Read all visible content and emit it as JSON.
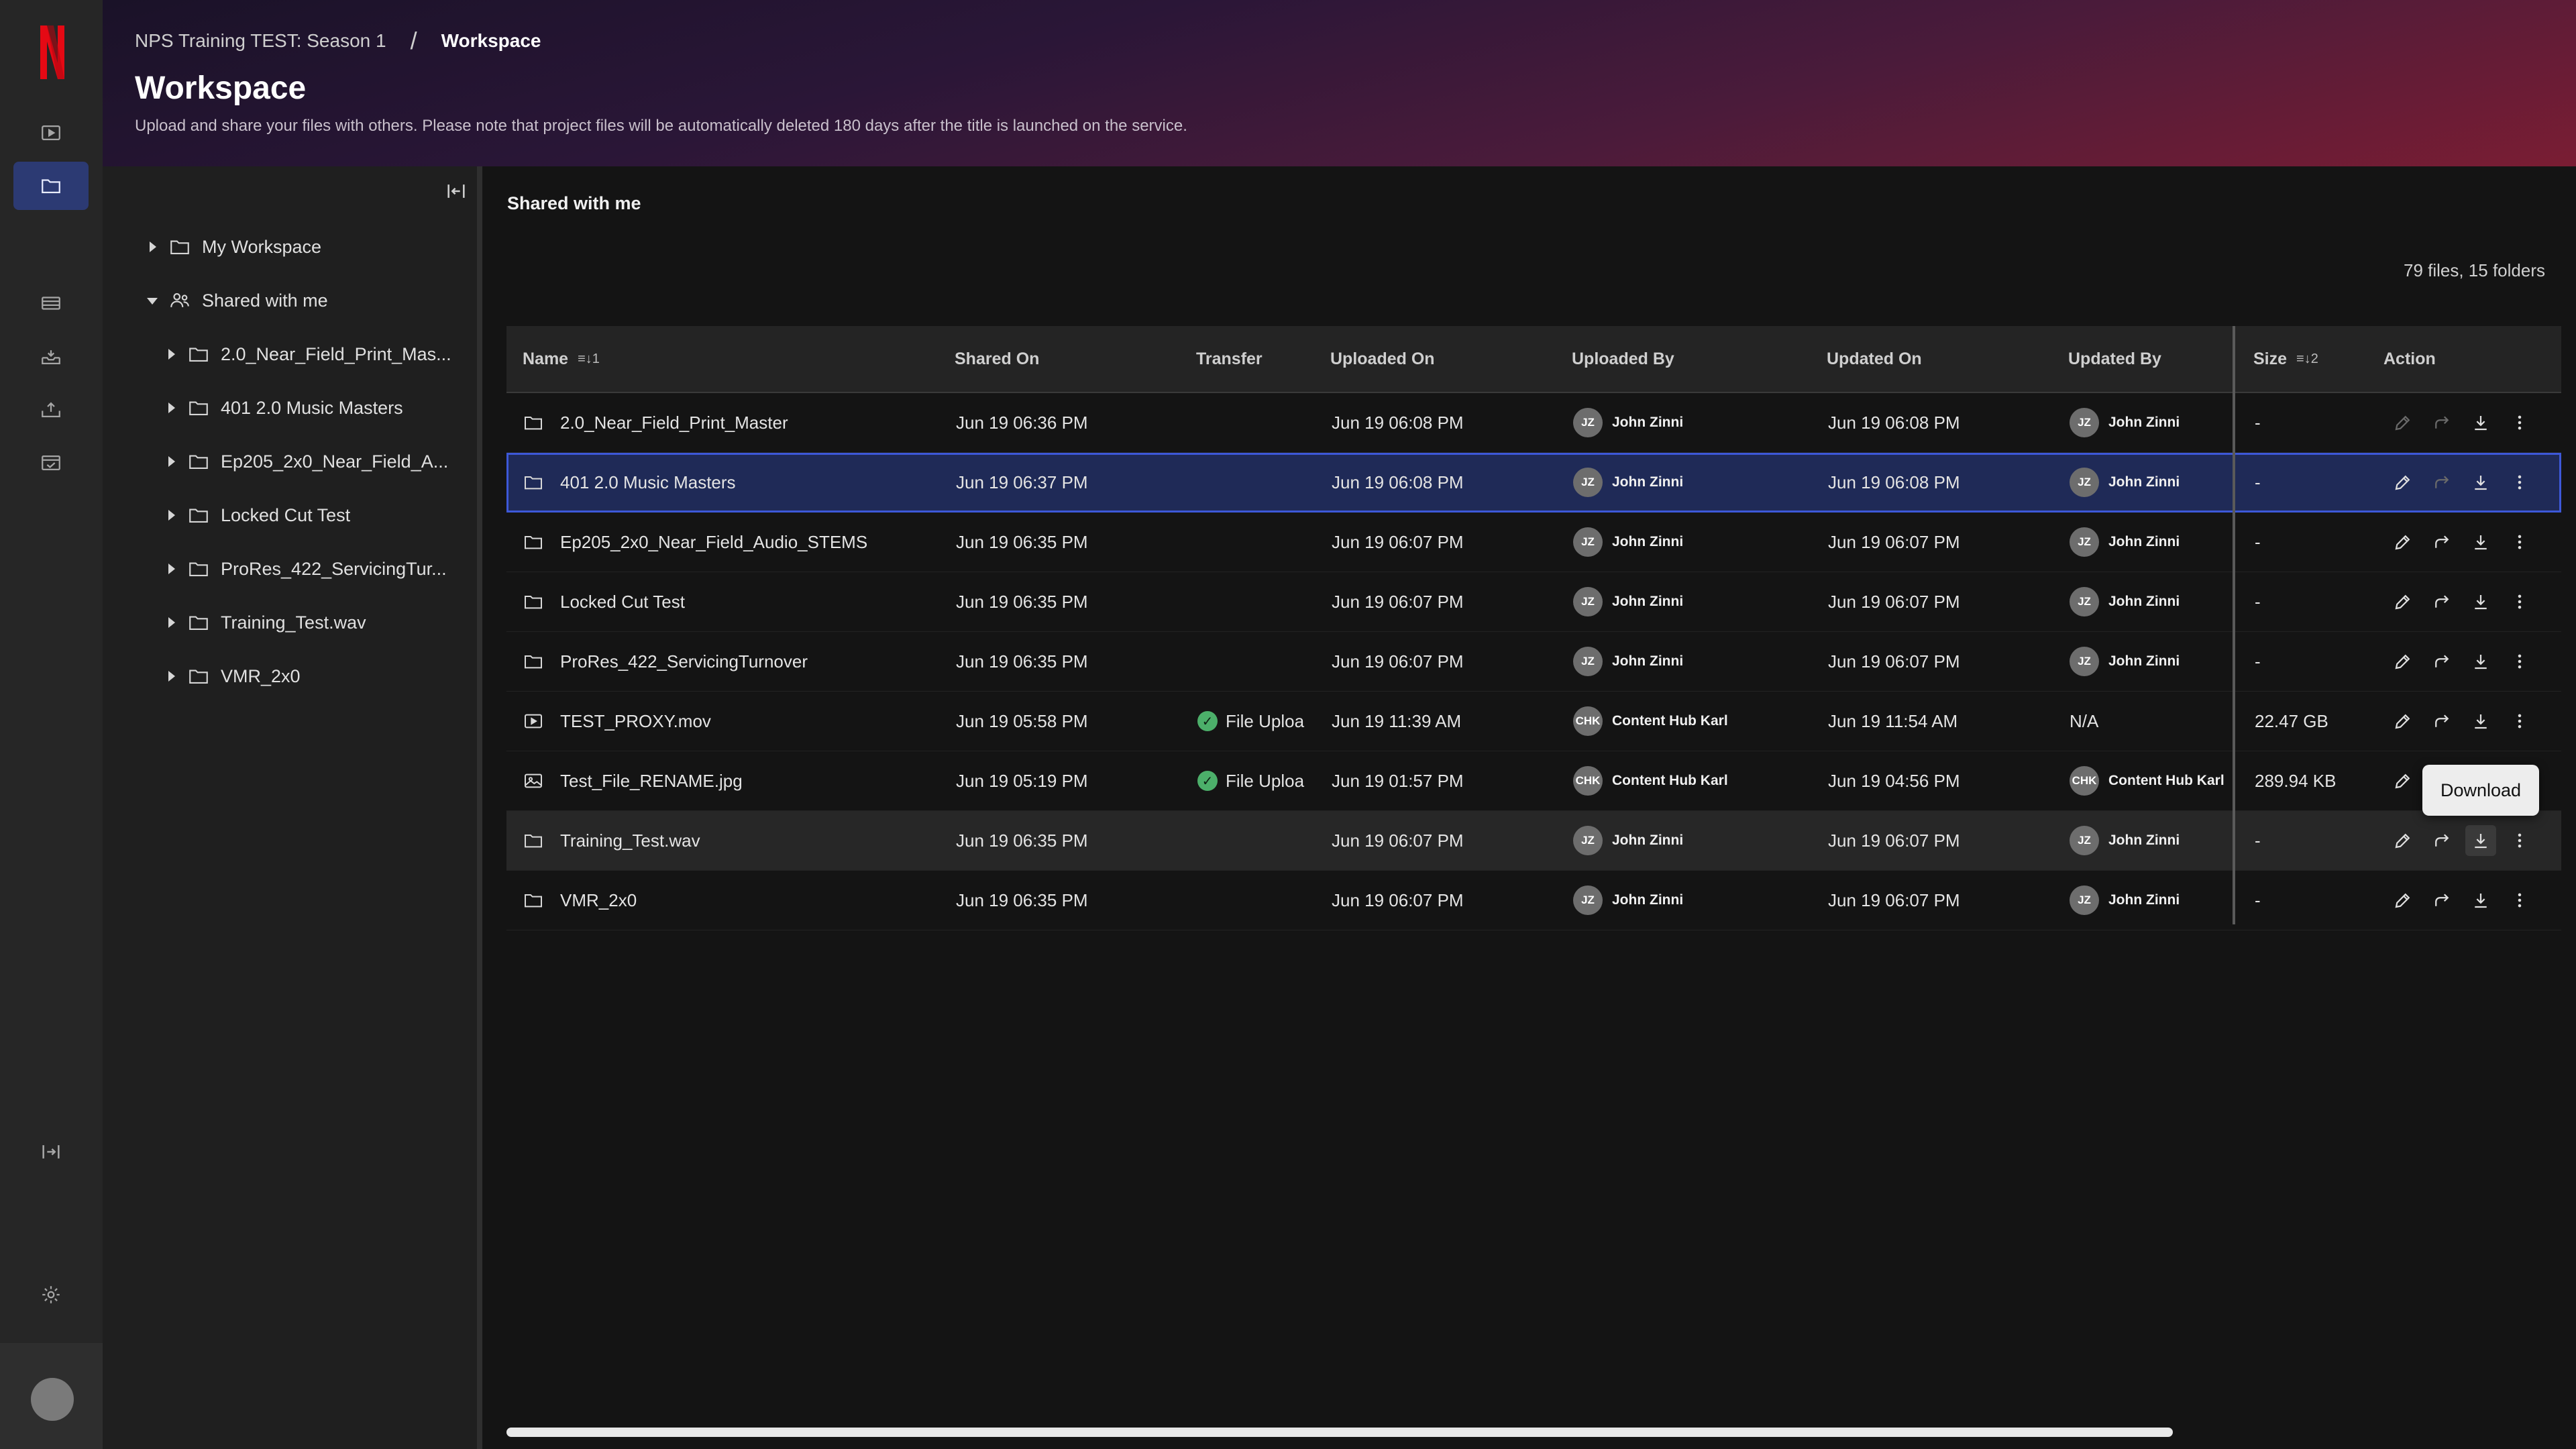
{
  "breadcrumb": {
    "project": "NPS Training TEST: Season 1",
    "separator": "/",
    "current": "Workspace"
  },
  "page": {
    "title": "Workspace",
    "description": "Upload and share your files with others. Please note that project files will be automatically deleted 180 days after the title is launched on the service."
  },
  "rail": {
    "logo": "N",
    "icons": [
      "play-icon",
      "folder-icon",
      "film-icon",
      "inbox-icon",
      "upload-icon",
      "calendar-check-icon",
      "expand-sidebar-icon",
      "gear-icon"
    ],
    "active": "folder-icon"
  },
  "tree": {
    "my_workspace": "My Workspace",
    "shared": "Shared with me",
    "children": [
      "2.0_Near_Field_Print_Mas...",
      "401 2.0 Music Masters",
      "Ep205_2x0_Near_Field_A...",
      "Locked Cut Test",
      "ProRes_422_ServicingTur...",
      "Training_Test.wav",
      "VMR_2x0"
    ]
  },
  "main": {
    "section_title": "Shared with me",
    "counts": "79 files, 15 folders",
    "columns": {
      "name": "Name",
      "name_sort": "≡↓1",
      "shared_on": "Shared On",
      "transfer": "Transfer",
      "uploaded_on": "Uploaded On",
      "uploaded_by": "Uploaded By",
      "updated_on": "Updated On",
      "updated_by": "Updated By",
      "size": "Size",
      "size_sort": "≡↓2",
      "action": "Action"
    },
    "rows": [
      {
        "type": "folder",
        "name": "2.0_Near_Field_Print_Master",
        "shared_on": "Jun 19 06:36 PM",
        "transfer": "",
        "uploaded_on": "Jun 19 06:08 PM",
        "uploaded_by_initials": "JZ",
        "uploaded_by": "John Zinni",
        "updated_on": "Jun 19 06:08 PM",
        "updated_by_initials": "JZ",
        "updated_by": "John Zinni",
        "size": "-"
      },
      {
        "type": "folder",
        "name": "401 2.0 Music Masters",
        "shared_on": "Jun 19 06:37 PM",
        "transfer": "",
        "uploaded_on": "Jun 19 06:08 PM",
        "uploaded_by_initials": "JZ",
        "uploaded_by": "John Zinni",
        "updated_on": "Jun 19 06:08 PM",
        "updated_by_initials": "JZ",
        "updated_by": "John Zinni",
        "size": "-"
      },
      {
        "type": "folder",
        "name": "Ep205_2x0_Near_Field_Audio_STEMS",
        "shared_on": "Jun 19 06:35 PM",
        "transfer": "",
        "uploaded_on": "Jun 19 06:07 PM",
        "uploaded_by_initials": "JZ",
        "uploaded_by": "John Zinni",
        "updated_on": "Jun 19 06:07 PM",
        "updated_by_initials": "JZ",
        "updated_by": "John Zinni",
        "size": "-"
      },
      {
        "type": "folder",
        "name": "Locked Cut Test",
        "shared_on": "Jun 19 06:35 PM",
        "transfer": "",
        "uploaded_on": "Jun 19 06:07 PM",
        "uploaded_by_initials": "JZ",
        "uploaded_by": "John Zinni",
        "updated_on": "Jun 19 06:07 PM",
        "updated_by_initials": "JZ",
        "updated_by": "John Zinni",
        "size": "-"
      },
      {
        "type": "folder",
        "name": "ProRes_422_ServicingTurnover",
        "shared_on": "Jun 19 06:35 PM",
        "transfer": "",
        "uploaded_on": "Jun 19 06:07 PM",
        "uploaded_by_initials": "JZ",
        "uploaded_by": "John Zinni",
        "updated_on": "Jun 19 06:07 PM",
        "updated_by_initials": "JZ",
        "updated_by": "John Zinni",
        "size": "-"
      },
      {
        "type": "video",
        "name": "TEST_PROXY.mov",
        "shared_on": "Jun 19 05:58 PM",
        "transfer": "File Uploa",
        "uploaded_on": "Jun 19 11:39 AM",
        "uploaded_by_initials": "CHK",
        "uploaded_by": "Content Hub Karl",
        "updated_on": "Jun 19 11:54 AM",
        "updated_by_initials": "",
        "updated_by": "N/A",
        "size": "22.47 GB"
      },
      {
        "type": "image",
        "name": "Test_File_RENAME.jpg",
        "shared_on": "Jun 19 05:19 PM",
        "transfer": "File Uploa",
        "uploaded_on": "Jun 19 01:57 PM",
        "uploaded_by_initials": "CHK",
        "uploaded_by": "Content Hub Karl",
        "updated_on": "Jun 19 04:56 PM",
        "updated_by_initials": "CHK",
        "updated_by": "Content Hub Karl",
        "size": "289.94 KB"
      },
      {
        "type": "folder",
        "name": "Training_Test.wav",
        "shared_on": "Jun 19 06:35 PM",
        "transfer": "",
        "uploaded_on": "Jun 19 06:07 PM",
        "uploaded_by_initials": "JZ",
        "uploaded_by": "John Zinni",
        "updated_on": "Jun 19 06:07 PM",
        "updated_by_initials": "JZ",
        "updated_by": "John Zinni",
        "size": "-"
      },
      {
        "type": "folder",
        "name": "VMR_2x0",
        "shared_on": "Jun 19 06:35 PM",
        "transfer": "",
        "uploaded_on": "Jun 19 06:07 PM",
        "uploaded_by_initials": "JZ",
        "uploaded_by": "John Zinni",
        "updated_on": "Jun 19 06:07 PM",
        "updated_by_initials": "JZ",
        "updated_by": "John Zinni",
        "size": "-"
      }
    ],
    "selected_row": 1,
    "hover_row": 7,
    "tooltip": "Download"
  },
  "colors": {
    "accent": "#3d58d8",
    "selected_bg": "#1f2a57",
    "success": "#4caf6a",
    "brand": "#e50914"
  }
}
